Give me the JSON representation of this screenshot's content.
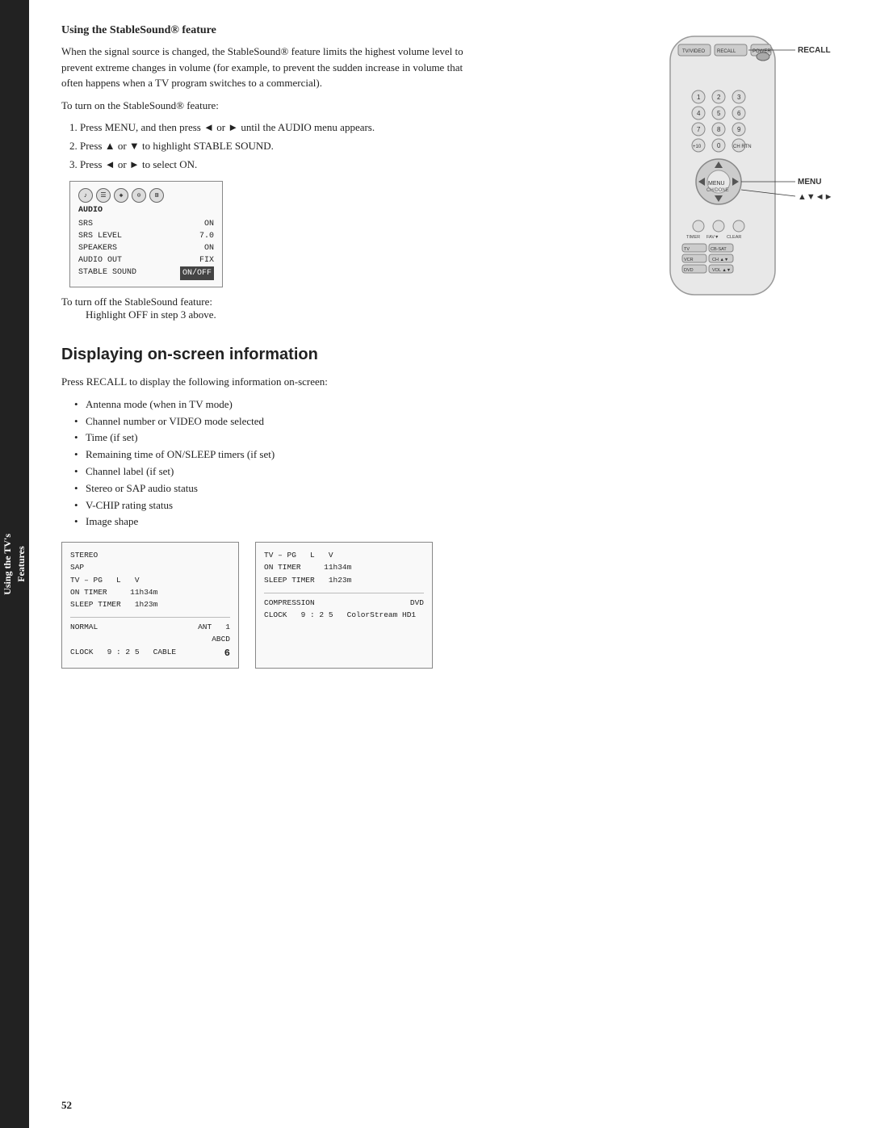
{
  "sidebar": {
    "line1": "Using the TV's",
    "line2": "Features"
  },
  "page_number": "52",
  "stable_sound": {
    "section_title": "Using the StableSound® feature",
    "body1": "When the signal source is changed, the StableSound® feature limits the highest volume level to prevent extreme changes in volume (for example, to prevent the sudden increase in volume that often happens when a TV program switches to a commercial).",
    "to_turn_on": "To turn on the StableSound® feature:",
    "step1": "1.  Press MENU, and then press ◄ or ► until the AUDIO menu appears.",
    "step2": "2.  Press ▲ or ▼ to highlight STABLE SOUND.",
    "step3": "3.  Press ◄ or ► to select ON.",
    "turn_off_text": "To turn off the StableSound feature:",
    "highlight_off": "Highlight OFF in step 3 above.",
    "audio_menu": {
      "icons": [
        "①",
        "②",
        "③",
        "④",
        "⑤"
      ],
      "label": "AUDIO",
      "rows": [
        {
          "key": "SRS",
          "val": "ON"
        },
        {
          "key": "SRS LEVEL",
          "val": "7.0"
        },
        {
          "key": "SPEAKERS",
          "val": "ON"
        },
        {
          "key": "AUDIO OUT",
          "val": "FIX"
        },
        {
          "key": "STABLE SOUND",
          "val": "ON/OFF",
          "highlight": true
        }
      ]
    }
  },
  "on_screen": {
    "heading": "Displaying on-screen information",
    "intro": "Press RECALL to display the following information on-screen:",
    "bullets": [
      "Antenna mode (when in TV mode)",
      "Channel number or VIDEO mode selected",
      "Time (if set)",
      "Remaining time of ON/SLEEP timers (if set)",
      "Channel label (if set)",
      "Stereo or SAP audio status",
      "V-CHIP rating status",
      "Image shape"
    ],
    "box1": {
      "line1": "STEREO",
      "line2": "SAP",
      "line3": "TV – PG    L    V",
      "line4": "ON TIMER    11h34m",
      "line5": "SLEEP TIMER   1h23m",
      "bottom1": "NORMAL",
      "bottom2": "ANT  1",
      "bottom3": "ABCD",
      "bottom4": "CLOCK  9 : 2 5   CABLE",
      "bottom5": "6"
    },
    "box2": {
      "line3": "TV – PG    L    V",
      "line4": "ON TIMER    11h34m",
      "line5": "SLEEP TIMER   1h23m",
      "bottom1": "COMPRESSION",
      "bottom2": "DVD",
      "bottom3": "CLOCK  9 : 2 5   ColorStream HD1"
    }
  },
  "remote": {
    "recall_label": "RECALL",
    "menu_label": "MENU",
    "arrows_label": "▲▼◄►"
  }
}
